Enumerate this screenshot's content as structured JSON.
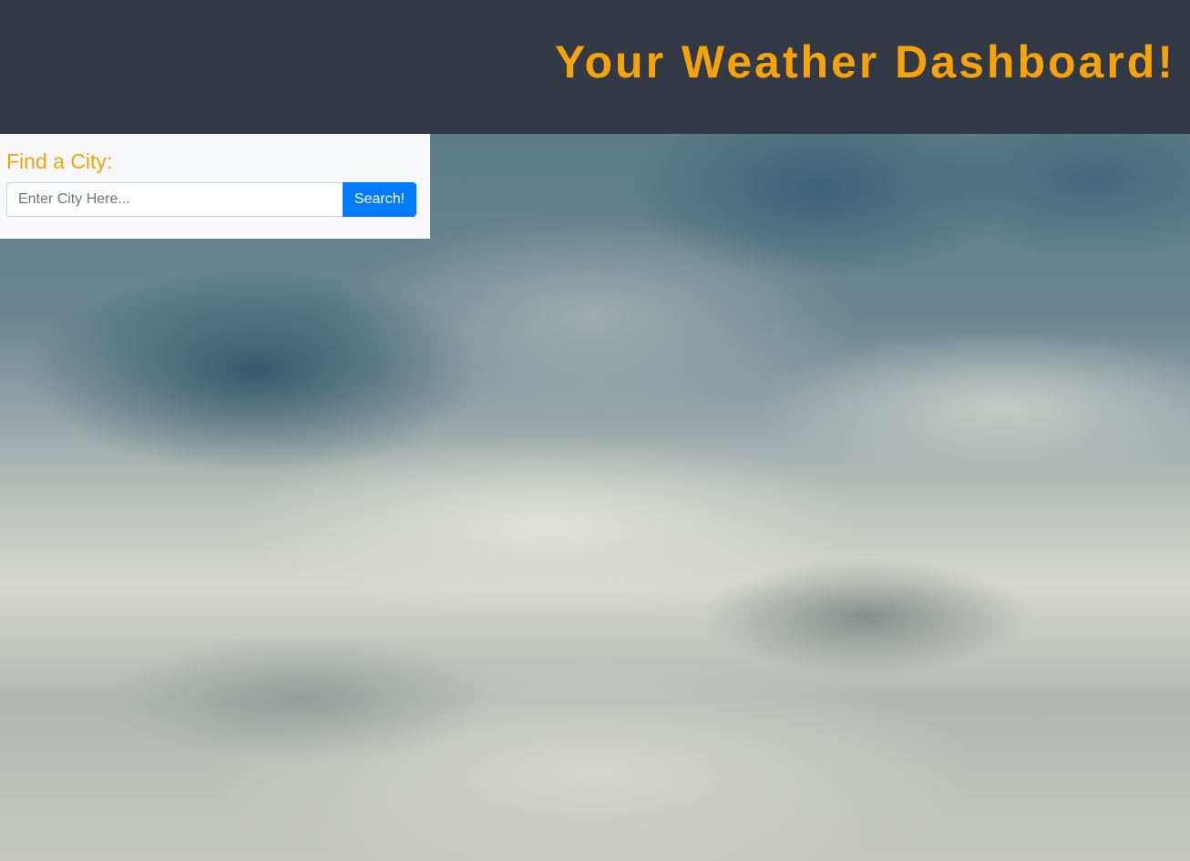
{
  "header": {
    "title": "Your Weather Dashboard!"
  },
  "search": {
    "label": "Find a City:",
    "placeholder": "Enter City Here...",
    "value": "",
    "button_label": "Search!"
  },
  "colors": {
    "header_bg": "#343a45",
    "title_accent": "#f5a30d",
    "button_primary": "#007bff",
    "panel_bg": "#f7f8fa"
  },
  "background": {
    "icon": "cloudy-sky-image"
  }
}
